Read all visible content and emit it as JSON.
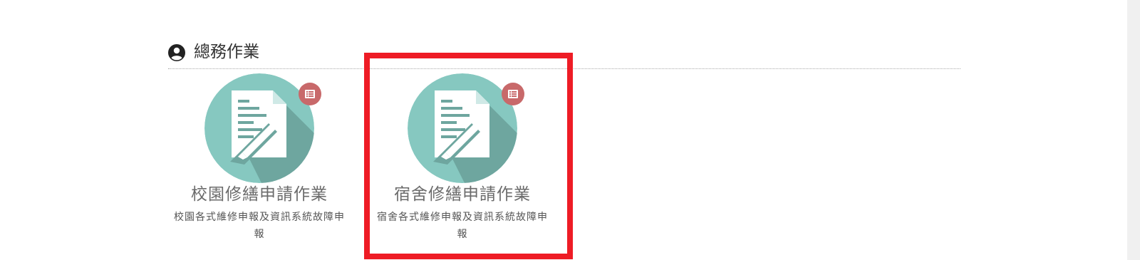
{
  "section": {
    "title": "總務作業",
    "icon": "user-circle-icon"
  },
  "cards": [
    {
      "title": "校園修繕申請作業",
      "description": "校園各式維修申報及資訊系統故障申報",
      "icon": "document-edit-icon",
      "badge_icon": "list-icon"
    },
    {
      "title": "宿舍修繕申請作業",
      "description": "宿舍各式維修申報及資訊系統故障申報",
      "icon": "document-edit-icon",
      "badge_icon": "list-icon"
    }
  ],
  "colors": {
    "circle": "#86c8c0",
    "circle_shadow": "#6ea69f",
    "badge": "#c8696a",
    "highlight": "#ee1c25"
  }
}
